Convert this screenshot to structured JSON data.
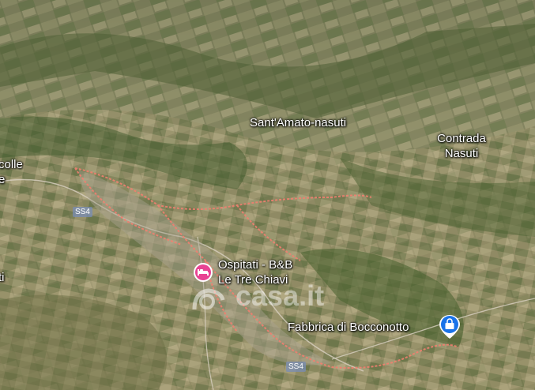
{
  "map": {
    "labels": {
      "santamato": "Sant'Amato-nasuti",
      "contrada_line1": "Contrada",
      "contrada_line2": "Nasuti",
      "left_top_line1": "colle",
      "left_top_line2": "e",
      "left_mid": "ti",
      "ospitati_line1": "Ospitati - B&B",
      "ospitati_line2": "Le Tre Chiavi",
      "fabbrica": "Fabbrica di Bocconotto"
    },
    "road_shields": [
      "SS4",
      "SS4"
    ],
    "watermark": "casa.it",
    "icons": {
      "lodging": "hotel-bed-icon",
      "shop": "shopping-bag-icon"
    },
    "colors": {
      "lodging_pin": "#e84393",
      "shop_pin": "#1a73e8",
      "boundary": "#f08070"
    }
  }
}
